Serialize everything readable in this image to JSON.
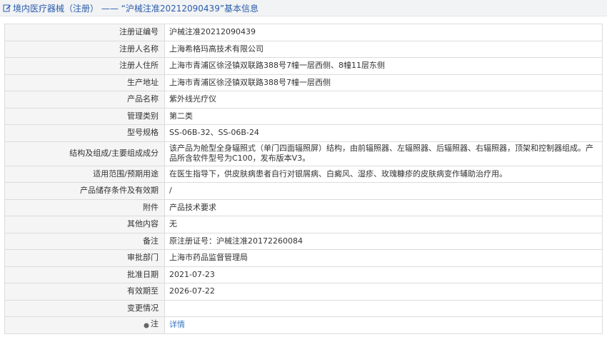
{
  "header": {
    "title": "境内医疗器械（注册）  ——  “沪械注准20212090439”基本信息"
  },
  "rows": [
    {
      "label": "注册证编号",
      "value": "沪械注准20212090439"
    },
    {
      "label": "注册人名称",
      "value": "上海希格玛高技术有限公司"
    },
    {
      "label": "注册人住所",
      "value": "上海市青浦区徐泾镇双联路388号7幢一层西侧、8幢11层东侧"
    },
    {
      "label": "生产地址",
      "value": "上海市青浦区徐泾镇双联路388号7幢一层西侧"
    },
    {
      "label": "产品名称",
      "value": "紫外线光疗仪"
    },
    {
      "label": "管理类别",
      "value": "第二类"
    },
    {
      "label": "型号规格",
      "value": "SS-06B-32、SS-06B-24"
    },
    {
      "label": "结构及组成/主要组成成分",
      "value": "该产品为舱型全身辐照式（单门四面辐照屏）结构，由前辐照器、左辐照器、后辐照器、右辐照器，顶架和控制器组成。产品所含软件型号为C100，发布版本V3。"
    },
    {
      "label": "适用范围/预期用途",
      "value": "在医生指导下，供皮肤病患者自行对银屑病、白癜风、湿疹、玫瑰糠疹的皮肤病变作辅助治疗用。"
    },
    {
      "label": "产品储存条件及有效期",
      "value": "/"
    },
    {
      "label": "附件",
      "value": "产品技术要求"
    },
    {
      "label": "其他内容",
      "value": "无"
    },
    {
      "label": "备注",
      "value": "原注册证号：沪械注准20172260084"
    },
    {
      "label": "审批部门",
      "value": "上海市药品监督管理局"
    },
    {
      "label": "批准日期",
      "value": "2021-07-23"
    },
    {
      "label": "有效期至",
      "value": "2026-07-22"
    },
    {
      "label": "变更情况",
      "value": ""
    }
  ],
  "note": {
    "label": "注",
    "link": "详情"
  }
}
